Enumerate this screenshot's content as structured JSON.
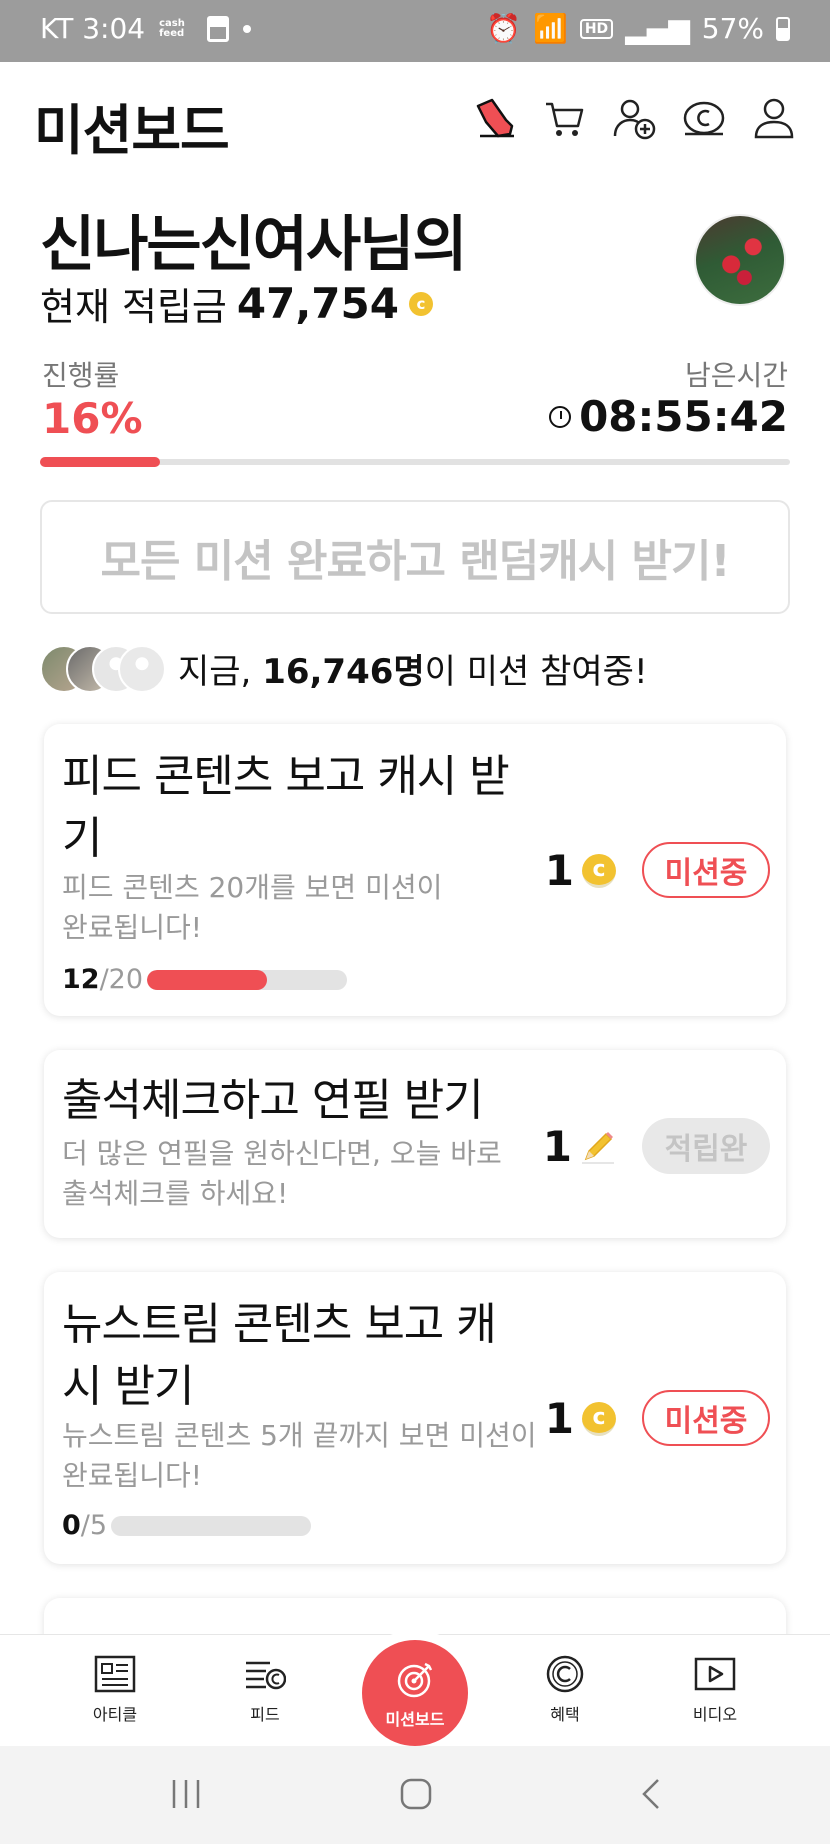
{
  "status_bar": {
    "carrier_time": "KT 3:04",
    "cash_label": "cash feed",
    "hd": "HD",
    "battery": "57%"
  },
  "header": {
    "title": "미션보드",
    "icons": [
      "shoe-icon",
      "cart-icon",
      "add-friend-icon",
      "cash-coin-icon",
      "profile-icon"
    ]
  },
  "user": {
    "name_line": "신나는신여사님의",
    "points_label": "현재 적립금",
    "points": "47,754",
    "coin_symbol": "c"
  },
  "progress": {
    "label": "진행률",
    "value_text": "16%",
    "value": 0.16,
    "time_label": "남은시간",
    "time_value": "08:55:42"
  },
  "all_missions_button": "모든 미션 완료하고 랜덤캐시 받기!",
  "participants": {
    "prefix": "지금,",
    "count": "16,746명",
    "suffix": "이 미션 참여중!"
  },
  "missions": [
    {
      "title": "피드 콘텐츠 보고 캐시 받기",
      "description": "피드 콘텐츠 20개를 보면 미션이 완료됩니다!",
      "done": "12",
      "total": "/20",
      "progress": 0.6,
      "reward": "1",
      "reward_type": "coin",
      "status": "미션중"
    },
    {
      "title": "출석체크하고 연필 받기",
      "description": "더 많은 연필을 원하신다면, 오늘 바로 출석체크를 하세요!",
      "reward": "1",
      "reward_type": "pencil",
      "status": "적립완"
    },
    {
      "title": "뉴스트림 콘텐츠 보고 캐시 받기",
      "description": "뉴스트림 콘텐츠 5개 끝까지 보면 미션이 완료됩니다!",
      "done": "0",
      "total": "/5",
      "progress": 0,
      "reward": "1",
      "reward_type": "coin",
      "status": "미션중"
    }
  ],
  "bottom_nav": {
    "article": "아티클",
    "feed": "피드",
    "mission_board": "미션보드",
    "benefits": "혜택",
    "video": "비디오"
  },
  "colors": {
    "accent": "#ef4f54",
    "coin": "#f2c230",
    "status_bar": "#9c9c9c"
  }
}
